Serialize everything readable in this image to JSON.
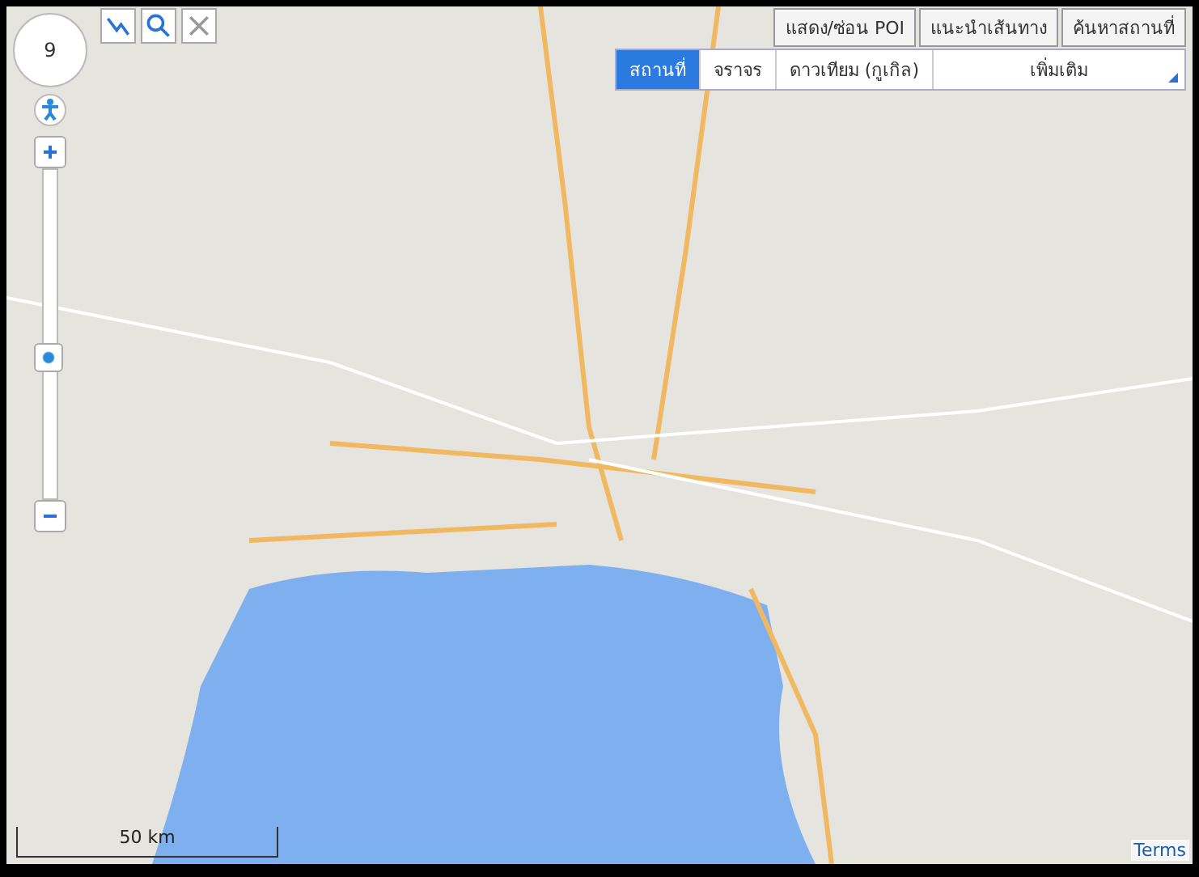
{
  "map": {
    "zoom_level": "9",
    "zoom_slider": {
      "level": 0.43
    },
    "scale": "50 km",
    "attribution_link": "Terms"
  },
  "top_buttons": [
    "แสดง/ซ่อน POI",
    "แนะนำเส้นทาง",
    "ค้นหาสถานที่"
  ],
  "layer_tabs": [
    {
      "label": "สถานที่",
      "selected": true
    },
    {
      "label": "จราจร",
      "selected": false
    },
    {
      "label": "ดาวเทียม (กูเกิล)",
      "selected": false
    }
  ],
  "more_dropdown": {
    "label": "เพิ่มเติม"
  }
}
